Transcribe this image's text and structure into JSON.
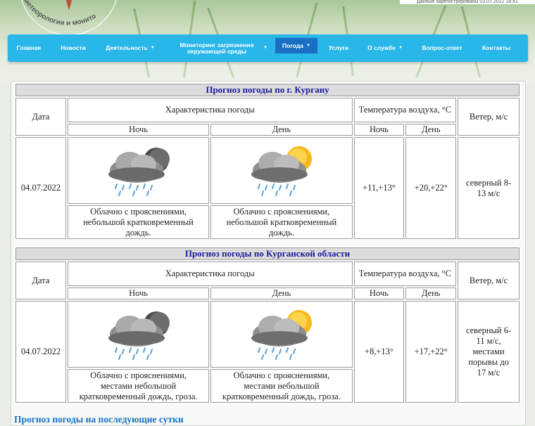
{
  "header": {
    "registration_text": "Данные зарегистрированы 03.07.2022 18:41",
    "logo_arc_text": "ометеорологии и монито"
  },
  "nav": {
    "items": [
      {
        "label": "Главная",
        "dropdown": false
      },
      {
        "label": "Новости",
        "dropdown": false
      },
      {
        "label": "Деятельность",
        "dropdown": true
      },
      {
        "label": "Мониторинг загрязнения окружающей среды",
        "dropdown": true
      },
      {
        "label": "Погода",
        "dropdown": true,
        "active": true
      },
      {
        "label": "Услуги",
        "dropdown": false
      },
      {
        "label": "О службе",
        "dropdown": true
      },
      {
        "label": "Вопрос-ответ",
        "dropdown": false
      },
      {
        "label": "Контакты",
        "dropdown": false
      }
    ]
  },
  "headers": {
    "date": "Дата",
    "characteristic": "Характеристика погоды",
    "temperature": "Температура воздуха, °С",
    "wind": "Ветер, м/с",
    "night": "Ночь",
    "day": "День"
  },
  "city_forecast": {
    "title": "Прогноз погоды по г. Кургану",
    "date": "04.07.2022",
    "night_icon": "cloud-moon-rain-icon",
    "day_icon": "cloud-sun-rain-icon",
    "night_description": "Облачно с прояснениями, небольшой кратковременный дождь.",
    "day_description": "Облачно с прояснениями, небольшой кратковременный дождь.",
    "night_temp": "+11,+13°",
    "day_temp": "+20,+22°",
    "wind": "северный 8-13 м/с"
  },
  "region_forecast": {
    "title": "Прогноз погоды по Курганской области",
    "date": "04.07.2022",
    "night_icon": "cloud-moon-rain-icon",
    "day_icon": "cloud-sun-rain-icon",
    "night_description": "Облачно с прояснениями, местами небольшой кратковременный дождь, гроза.",
    "day_description": "Облачно с прояснениями, местами небольшой кратковременный дождь, гроза.",
    "night_temp": "+8,+13°",
    "day_temp": "+17,+22°",
    "wind": "северный 6-11 м/с, местами порывы до 17 м/с"
  },
  "next_days_link": "Прогноз погоды на последующие сутки",
  "colors": {
    "nav_bg": "#29b6e8",
    "nav_active": "#1a6fc4",
    "title_text": "#1a1a9c"
  }
}
